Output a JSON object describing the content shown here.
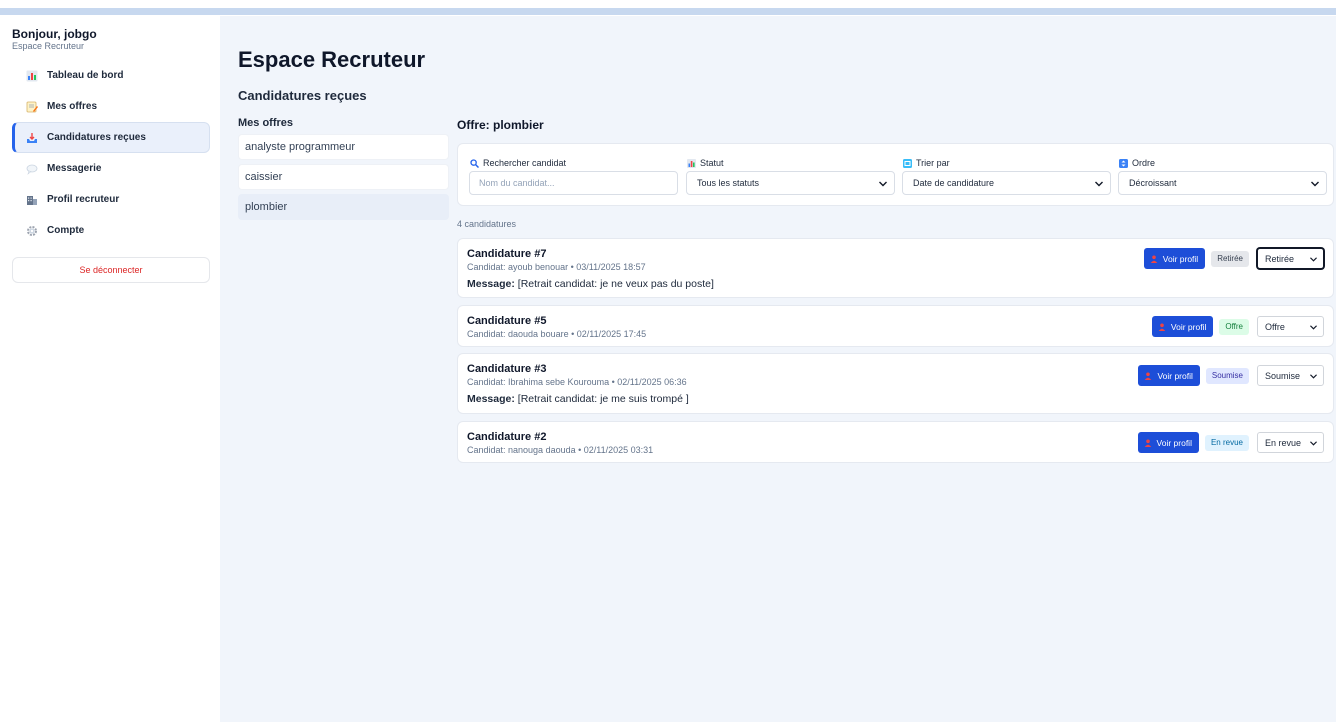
{
  "sidebar": {
    "greeting": "Bonjour, jobgo",
    "subtitle": "Espace Recruteur",
    "items": [
      {
        "label": "Tableau de bord",
        "icon": "bar-chart-icon"
      },
      {
        "label": "Mes offres",
        "icon": "memo-icon"
      },
      {
        "label": "Candidatures reçues",
        "icon": "inbox-tray-icon"
      },
      {
        "label": "Messagerie",
        "icon": "speech-bubble-icon"
      },
      {
        "label": "Profil recruteur",
        "icon": "building-icon"
      },
      {
        "label": "Compte",
        "icon": "gear-icon"
      }
    ],
    "logout_label": "Se déconnecter"
  },
  "main": {
    "title": "Espace Recruteur",
    "subtitle": "Candidatures reçues",
    "offers_title": "Mes offres",
    "offers": [
      "analyste programmeur",
      "caissier",
      "plombier"
    ],
    "selected_offer_title": "Offre: plombier",
    "filters": {
      "search_label": "Rechercher candidat",
      "search_placeholder": "Nom du candidat...",
      "status_label": "Statut",
      "status_value": "Tous les statuts",
      "sort_label": "Trier par",
      "sort_value": "Date de candidature",
      "order_label": "Ordre",
      "order_value": "Décroissant"
    },
    "count": "4 candidatures",
    "view_profile_label": "Voir profil",
    "message_label": "Message:",
    "applications": [
      {
        "title": "Candidature #7",
        "meta": "Candidat: ayoub benouar • 03/11/2025 18:57",
        "message": "[Retrait candidat: je ne veux pas du poste]",
        "badge": "Retirée",
        "status": "Retirée"
      },
      {
        "title": "Candidature #5",
        "meta": "Candidat: daouda bouare • 02/11/2025 17:45",
        "message": "",
        "badge": "Offre",
        "status": "Offre"
      },
      {
        "title": "Candidature #3",
        "meta": "Candidat: Ibrahima sebe Kourouma • 02/11/2025 06:36",
        "message": "[Retrait candidat: je me suis trompé ]",
        "badge": "Soumise",
        "status": "Soumise"
      },
      {
        "title": "Candidature #2",
        "meta": "Candidat: nanouga daouda • 02/11/2025 03:31",
        "message": "",
        "badge": "En revue",
        "status": "En revue"
      }
    ]
  },
  "colors": {
    "accent": "#2563eb",
    "button": "#1d4ed8",
    "danger": "#dc2626",
    "badge_retiree": "#e5e7eb",
    "badge_offre": "#dcfce7",
    "badge_soumise": "#e0e7ff",
    "badge_revue": "#e0f2fe"
  }
}
